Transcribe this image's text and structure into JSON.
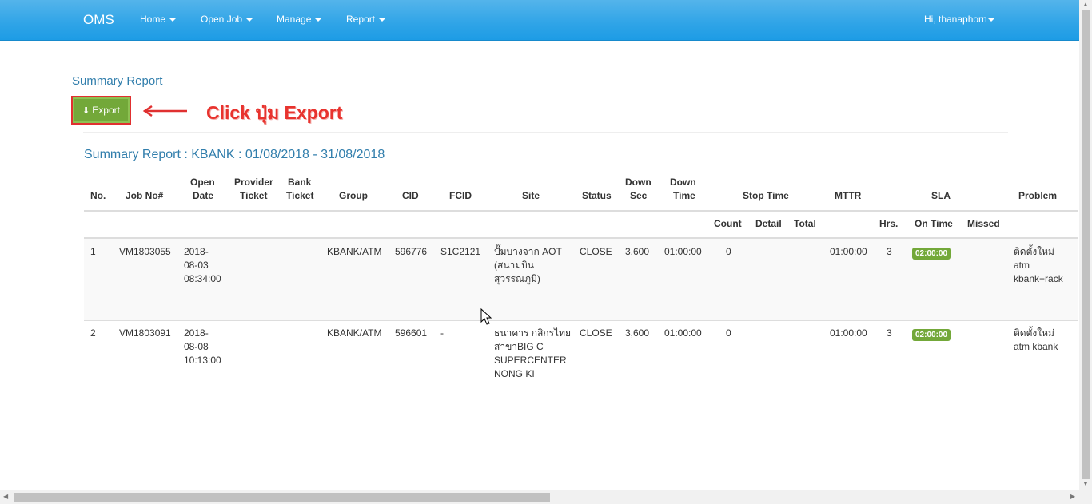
{
  "navbar": {
    "brand": "OMS",
    "items": [
      "Home",
      "Open Job",
      "Manage",
      "Report"
    ],
    "user": "Hi, thanaphorn"
  },
  "page_heading": "Summary Report",
  "export_button": "Export",
  "annotation": "Click ปุ่ม Export",
  "report_title": "Summary Report : KBANK : 01/08/2018 - 31/08/2018",
  "table": {
    "headers": {
      "no": "No.",
      "job_no": "Job No#",
      "open_date": [
        "Open",
        "Date"
      ],
      "provider_ticket": [
        "Provider",
        "Ticket"
      ],
      "bank_ticket": [
        "Bank",
        "Ticket"
      ],
      "group": "Group",
      "cid": "CID",
      "fcid": "FCID",
      "site": "Site",
      "status": "Status",
      "down_sec": [
        "Down",
        "Sec"
      ],
      "down_time": [
        "Down",
        "Time"
      ],
      "stop_time": "Stop Time",
      "mttr": "MTTR",
      "sla": "SLA",
      "problem": "Problem"
    },
    "subheaders": {
      "count": "Count",
      "detail": "Detail",
      "total": "Total",
      "hrs": "Hrs.",
      "on_time": "On Time",
      "missed": "Missed"
    },
    "rows": [
      {
        "no": "1",
        "job_no": "VM1803055",
        "open_date": [
          "2018-",
          "08-03",
          "08:34:00"
        ],
        "group": "KBANK/ATM",
        "cid": "596776",
        "fcid": "S1C2121",
        "site": [
          "ปั๊มบางจาก AOT",
          "(สนามบิน",
          "สุวรรณภูมิ)"
        ],
        "status": "CLOSE",
        "down_sec": "3,600",
        "down_time": "01:00:00",
        "count": "0",
        "mttr": "01:00:00",
        "hrs": "3",
        "on_time": "02:00:00",
        "problem": [
          "ติดตั้งใหม่",
          "atm",
          "kbank+rack"
        ]
      },
      {
        "no": "2",
        "job_no": "VM1803091",
        "open_date": [
          "2018-",
          "08-08",
          "10:13:00"
        ],
        "group": "KBANK/ATM",
        "cid": "596601",
        "fcid": "-",
        "site": [
          "ธนาคาร กสิกรไทย",
          "สาขาBIG C",
          "SUPERCENTER",
          "NONG KI"
        ],
        "status": "CLOSE",
        "down_sec": "3,600",
        "down_time": "01:00:00",
        "count": "0",
        "mttr": "01:00:00",
        "hrs": "3",
        "on_time": "02:00:00",
        "problem": [
          "ติดตั้งใหม่",
          "atm kbank"
        ]
      }
    ]
  }
}
